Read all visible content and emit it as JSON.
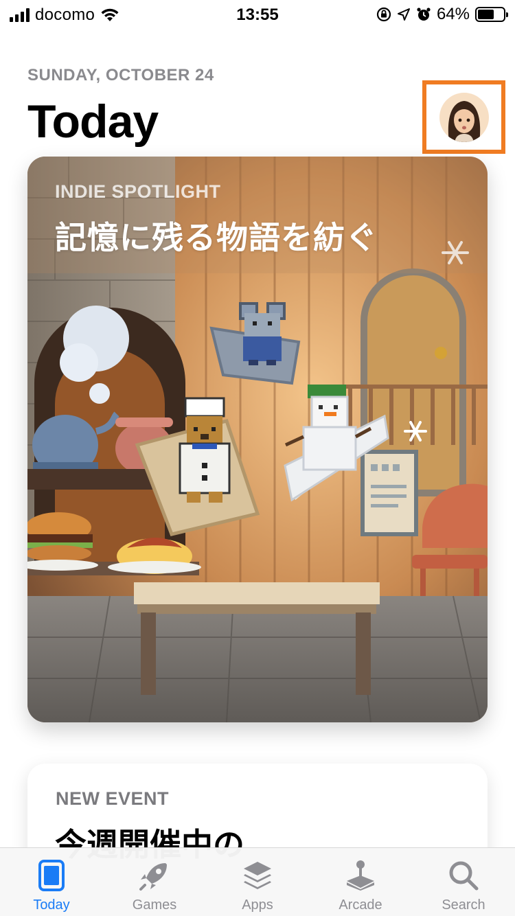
{
  "status_bar": {
    "carrier": "docomo",
    "time": "13:55",
    "battery_percent": "64%",
    "battery_level": 0.64,
    "icons": [
      "signal-icon",
      "wifi-icon",
      "orientation-lock-icon",
      "location-icon",
      "alarm-icon",
      "battery-icon"
    ]
  },
  "header": {
    "date": "SUNDAY, OCTOBER 24",
    "title": "Today",
    "avatar_highlight_color": "#f07c22"
  },
  "cards": [
    {
      "eyebrow": "INDIE SPOTLIGHT",
      "headline": "記憶に残る物語を紡ぐ"
    },
    {
      "eyebrow": "NEW EVENT",
      "headline": "今週開催中の"
    }
  ],
  "tab_bar": {
    "active_color": "#1a7cf6",
    "inactive_color": "#8e8e93",
    "tabs": [
      {
        "label": "Today",
        "icon": "today-icon",
        "active": true
      },
      {
        "label": "Games",
        "icon": "rocket-icon",
        "active": false
      },
      {
        "label": "Apps",
        "icon": "apps-stack-icon",
        "active": false
      },
      {
        "label": "Arcade",
        "icon": "joystick-icon",
        "active": false
      },
      {
        "label": "Search",
        "icon": "search-icon",
        "active": false
      }
    ]
  }
}
